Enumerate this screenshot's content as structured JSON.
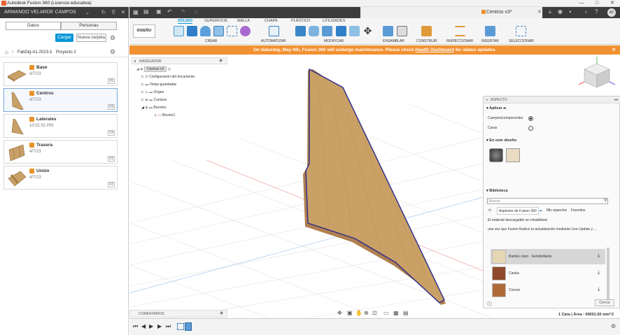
{
  "app": {
    "title": "Autodesk Fusion 360 (Licencia educativa)"
  },
  "left": {
    "user": "ARMANDO VELARDE CAMPOS",
    "tab_data": "Datos",
    "tab_people": "Personas",
    "upload": "Cargar",
    "new_folder": "Nueva carpeta",
    "crumbs": [
      "FabDig-A1-2023-1",
      "Proyecto 2"
    ],
    "files": [
      {
        "name": "Base",
        "date": "4/7/23",
        "version": "V5"
      },
      {
        "name": "Centros",
        "date": "4/7/23",
        "version": "V3"
      },
      {
        "name": "Laterales",
        "date": "10:01:51 PM",
        "version": "V4"
      },
      {
        "name": "Trasera",
        "date": "4/7/23",
        "version": "V3"
      },
      {
        "name": "Unión",
        "date": "4/7/23",
        "version": "V3"
      }
    ]
  },
  "doc": {
    "tab": "Centros v3*"
  },
  "toolbar": {
    "tabs": [
      "SÓLIDO",
      "SUPERFICIE",
      "MALLA",
      "CHAPA",
      "PLÁSTICO",
      "UTILIDADES"
    ],
    "design": "DISEÑO",
    "groups": [
      "CREAR",
      "AUTOMATIZAR",
      "MODIFICAR",
      "ENSAMBLAR",
      "CONSTRUIR",
      "INSPECCIONAR",
      "INSERTAR",
      "SELECCIONAR"
    ]
  },
  "banner": {
    "text": "On Saturday, May 6th, Fusion 360 will undergo maintenance. Please check",
    "link": "Health Dashboard",
    "tail": "for status updates."
  },
  "navigator": {
    "title": "NAVEGADOR",
    "root": "Centros v3",
    "items": [
      "Configuración del documento",
      "Vistas guardadas",
      "Origen",
      "Cuerpos",
      "Bocetos",
      "Boceto1"
    ]
  },
  "aspecto": {
    "title": "ASPECTO",
    "apply": "Aplicar a:",
    "opt1": "Cuerpos/componentes",
    "opt2": "Caras",
    "in_design": "En este diseño",
    "library": "Biblioteca",
    "search_ph": "Buscar",
    "lib_tabs": [
      "Aspectos de Fusion 360",
      "Mis aspectos",
      "Favoritos"
    ],
    "note1": "El material descargable se rehabilitará",
    "note2": "una vez que Fusion finalice la actualización mediante Live Update y ...",
    "materials": [
      "Bambú claro - Semibrillante",
      "Caoba",
      "Cerezo"
    ],
    "close": "Cerrar"
  },
  "comments": "COMENTARIOS",
  "status": "1 Cara | Área : 69001.50 mm^2",
  "colors": {
    "accent": "#0696d7",
    "banner": "#f29132",
    "wood": "#c9a066",
    "edge": "#2a2a8a"
  }
}
